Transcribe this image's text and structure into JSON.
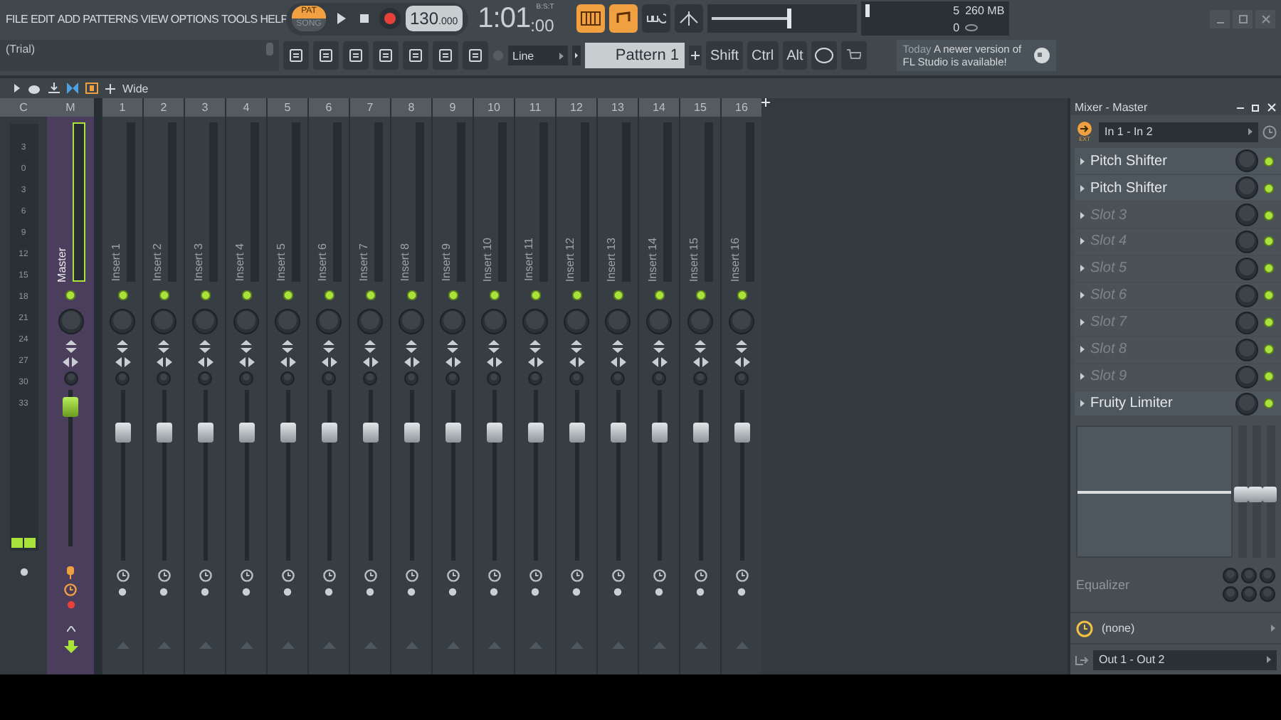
{
  "menu": [
    "FILE",
    "EDIT",
    "ADD",
    "PATTERNS",
    "VIEW",
    "OPTIONS",
    "TOOLS",
    "HELP"
  ],
  "transport": {
    "modes": [
      {
        "label": "PAT",
        "selected": true
      },
      {
        "label": "SONG",
        "selected": false
      }
    ],
    "tempo": "130",
    "tempo_fraction": ".000",
    "time": "1:01",
    "time_ticks": ":00",
    "time_format": "B:S:T"
  },
  "master_pitch": {
    "level": 0.56
  },
  "monitor": {
    "voices": "5",
    "memory": "260 MB",
    "polyphony": "0"
  },
  "hint": "(Trial)",
  "snap": "Line",
  "pattern": "Pattern 1",
  "modifier_keys": [
    "Shift",
    "Ctrl",
    "Alt"
  ],
  "news": {
    "date": "Today",
    "message": "A newer version of FL Studio is available!"
  },
  "mixer": {
    "view_mode": "Wide",
    "current_label": "C",
    "scale": [
      "3",
      "0",
      "3",
      "6",
      "9",
      "12",
      "15",
      "18",
      "21",
      "24",
      "27",
      "30",
      "33"
    ],
    "master": {
      "label": "M",
      "name": "Master",
      "selected": true,
      "level": 0.95
    },
    "inserts": [
      {
        "number": "1",
        "name": "Insert 1",
        "selected": false,
        "level": 0.78
      },
      {
        "number": "2",
        "name": "Insert 2",
        "selected": false,
        "level": 0.78
      },
      {
        "number": "3",
        "name": "Insert 3",
        "selected": false,
        "level": 0.78
      },
      {
        "number": "4",
        "name": "Insert 4",
        "selected": false,
        "level": 0.78
      },
      {
        "number": "5",
        "name": "Insert 5",
        "selected": false,
        "level": 0.78
      },
      {
        "number": "6",
        "name": "Insert 6",
        "selected": false,
        "level": 0.78
      },
      {
        "number": "7",
        "name": "Insert 7",
        "selected": false,
        "level": 0.78
      },
      {
        "number": "8",
        "name": "Insert 8",
        "selected": false,
        "level": 0.78
      },
      {
        "number": "9",
        "name": "Insert 9",
        "selected": false,
        "level": 0.78
      },
      {
        "number": "10",
        "name": "Insert 10",
        "selected": false,
        "level": 0.78
      },
      {
        "number": "11",
        "name": "Insert 11",
        "selected": false,
        "level": 0.78
      },
      {
        "number": "12",
        "name": "Insert 12",
        "selected": false,
        "level": 0.78
      },
      {
        "number": "13",
        "name": "Insert 13",
        "selected": false,
        "level": 0.78
      },
      {
        "number": "14",
        "name": "Insert 14",
        "selected": false,
        "level": 0.78
      },
      {
        "number": "15",
        "name": "Insert 15",
        "selected": false,
        "level": 0.78
      },
      {
        "number": "16",
        "name": "Insert 16",
        "selected": false,
        "level": 0.78
      }
    ]
  },
  "panel": {
    "title": "Mixer - Master",
    "input_badge": "EXT",
    "input": "In 1 - In 2",
    "slots": [
      {
        "name": "Pitch Shifter",
        "empty": false
      },
      {
        "name": "Pitch Shifter",
        "empty": false
      },
      {
        "name": "Slot 3",
        "empty": true
      },
      {
        "name": "Slot 4",
        "empty": true
      },
      {
        "name": "Slot 5",
        "empty": true
      },
      {
        "name": "Slot 6",
        "empty": true
      },
      {
        "name": "Slot 7",
        "empty": true
      },
      {
        "name": "Slot 8",
        "empty": true
      },
      {
        "name": "Slot 9",
        "empty": true
      },
      {
        "name": "Fruity Limiter",
        "empty": false
      }
    ],
    "eq_bands": [
      {
        "level": 0.5
      },
      {
        "level": 0.5
      },
      {
        "level": 0.5
      }
    ],
    "eq_label": "Equalizer",
    "routing": "(none)",
    "output": "Out 1 - Out 2"
  }
}
